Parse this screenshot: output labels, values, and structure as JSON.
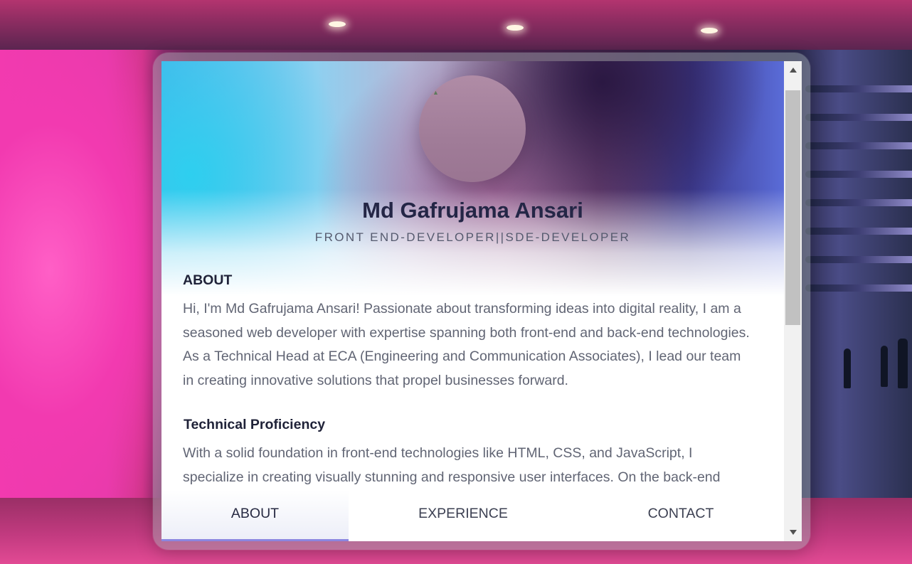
{
  "profile": {
    "name": "Md Gafrujama Ansari",
    "role": "FRONT END-DEVELOPER||SDE-DEVELOPER",
    "avatar_icon": "broken-image-icon"
  },
  "about": {
    "heading": "ABOUT",
    "text": "Hi, I'm Md Gafrujama Ansari! Passionate about transforming ideas into digital reality, I am a seasoned web developer with expertise spanning both front-end and back-end technologies. As a Technical Head at ECA (Engineering and Communication Associates), I lead our team in creating innovative solutions that propel businesses forward."
  },
  "proficiency": {
    "heading": "Technical Proficiency",
    "text": "With a solid foundation in front-end technologies like HTML, CSS, and JavaScript, I specialize in creating visually stunning and responsive user interfaces. On the back-end side, I harness powerful frameworks to build robust and scalable applications."
  },
  "tabs": [
    {
      "label": "ABOUT",
      "active": true
    },
    {
      "label": "EXPERIENCE",
      "active": false
    },
    {
      "label": "CONTACT",
      "active": false
    }
  ],
  "colors": {
    "tab_indicator": "#8b86e0",
    "heading": "#242646",
    "body_text": "#616574"
  }
}
